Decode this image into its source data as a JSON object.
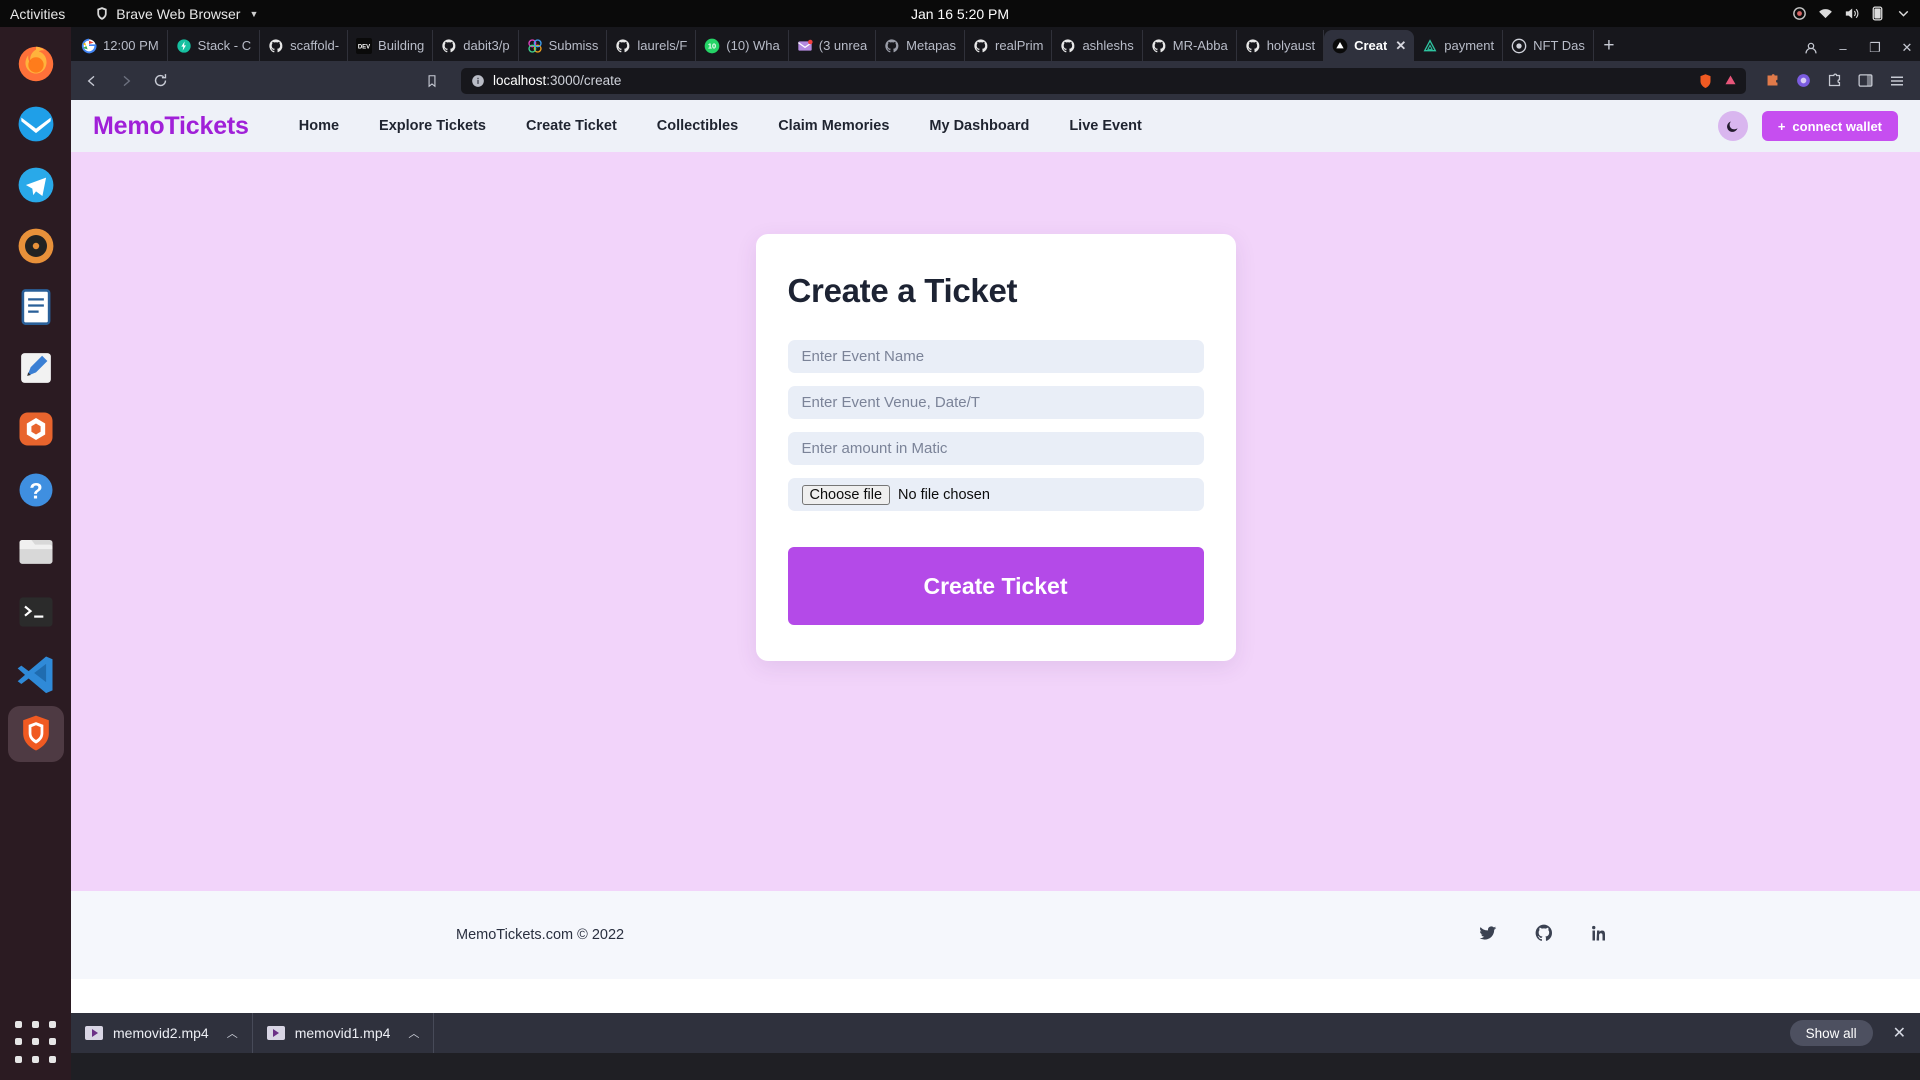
{
  "os": {
    "activities": "Activities",
    "app_name": "Brave Web Browser",
    "clock": "Jan 16  5:20 PM"
  },
  "dock": {
    "items": [
      {
        "name": "firefox",
        "label": "Firefox"
      },
      {
        "name": "thunderbird",
        "label": "Thunderbird"
      },
      {
        "name": "telegram",
        "label": "Telegram"
      },
      {
        "name": "rhythmbox",
        "label": "Rhythmbox"
      },
      {
        "name": "libreoffice-writer",
        "label": "LibreOffice Writer"
      },
      {
        "name": "text-editor",
        "label": "Text Editor"
      },
      {
        "name": "ubuntu-software",
        "label": "Ubuntu Software"
      },
      {
        "name": "help",
        "label": "Help"
      },
      {
        "name": "files",
        "label": "Files"
      },
      {
        "name": "terminal",
        "label": "Terminal"
      },
      {
        "name": "vscode",
        "label": "Visual Studio Code"
      },
      {
        "name": "brave",
        "label": "Brave Browser"
      }
    ],
    "show_apps": "Show Applications"
  },
  "browser": {
    "tabs": [
      {
        "title": "12:00 PM",
        "favicon": "google",
        "active": false
      },
      {
        "title": "Stack - C",
        "favicon": "teal-bolt",
        "active": false
      },
      {
        "title": "scaffold-",
        "favicon": "github",
        "active": false
      },
      {
        "title": "Building",
        "favicon": "dev",
        "active": false
      },
      {
        "title": "dabit3/p",
        "favicon": "github",
        "active": false
      },
      {
        "title": "Submiss",
        "favicon": "colorful",
        "active": false
      },
      {
        "title": "laurels/F",
        "favicon": "github",
        "active": false
      },
      {
        "title": "(10) Wha",
        "favicon": "whatsapp",
        "active": false
      },
      {
        "title": "(3 unrea",
        "favicon": "mail",
        "active": false
      },
      {
        "title": "Metapas",
        "favicon": "github",
        "active": false
      },
      {
        "title": "realPrim",
        "favicon": "github",
        "active": false
      },
      {
        "title": "ashleshs",
        "favicon": "github",
        "active": false
      },
      {
        "title": "MR-Abba",
        "favicon": "github",
        "active": false
      },
      {
        "title": "holyaust",
        "favicon": "github",
        "active": false
      },
      {
        "title": "Creat",
        "favicon": "vercel",
        "active": true
      },
      {
        "title": "payment",
        "favicon": "alchemy",
        "active": false
      },
      {
        "title": "NFT Das",
        "favicon": "nft",
        "active": false
      }
    ],
    "new_tab_label": "+",
    "url": "localhost:3000/create",
    "url_host": "localhost",
    "url_path": ":3000/create",
    "back_label": "Back",
    "forward_label": "Forward",
    "reload_label": "Reload",
    "bookmark_label": "Bookmark this page",
    "window_minimize": "–",
    "window_maximize": "❐",
    "window_close": "✕"
  },
  "site": {
    "brand": "MemoTickets",
    "nav": [
      {
        "label": "Home"
      },
      {
        "label": "Explore Tickets"
      },
      {
        "label": "Create Ticket"
      },
      {
        "label": "Collectibles"
      },
      {
        "label": "Claim Memories"
      },
      {
        "label": "My Dashboard"
      },
      {
        "label": "Live Event"
      }
    ],
    "theme_toggle_icon": "moon-icon",
    "wallet_button": "connect wallet",
    "wallet_plus": "+",
    "accent_color": "#b44ae8",
    "brand_color": "#a020d8",
    "page_bg": "#f2d4fa"
  },
  "form": {
    "title": "Create a Ticket",
    "event_name_placeholder": "Enter Event Name",
    "event_name_value": "",
    "event_venue_placeholder": "Enter Event Venue, Date/T",
    "event_venue_value": "",
    "amount_placeholder": "Enter amount in Matic",
    "amount_value": "",
    "file_button": "Choose file",
    "file_status": "No file chosen",
    "submit_label": "Create Ticket"
  },
  "footer": {
    "copyright": "MemoTickets.com © 2022",
    "social": [
      {
        "name": "twitter-icon"
      },
      {
        "name": "github-icon"
      },
      {
        "name": "linkedin-icon"
      }
    ]
  },
  "downloads": {
    "items": [
      {
        "filename": "memovid2.mp4"
      },
      {
        "filename": "memovid1.mp4"
      }
    ],
    "show_all": "Show all",
    "close": "✕"
  }
}
